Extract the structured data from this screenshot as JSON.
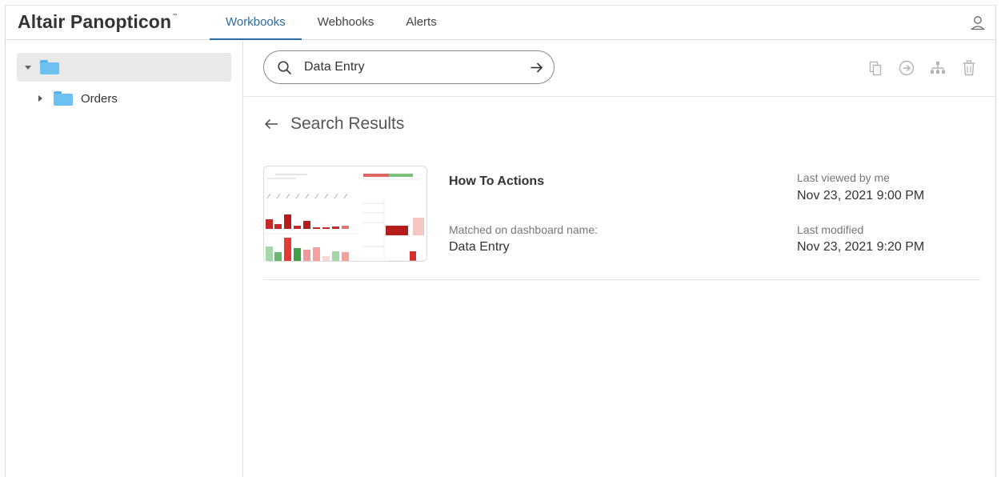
{
  "header": {
    "brand": "Altair Panopticon",
    "brand_mark": "™",
    "tabs": [
      {
        "label": "Workbooks",
        "active": true
      },
      {
        "label": "Webhooks",
        "active": false
      },
      {
        "label": "Alerts",
        "active": false
      }
    ],
    "user_icon": "user-icon"
  },
  "sidebar": {
    "root_label": "",
    "items": [
      {
        "label": "Orders"
      }
    ]
  },
  "toolbar": {
    "search": {
      "value": "Data Entry",
      "placeholder": ""
    },
    "actions": [
      "copy-icon",
      "move-icon",
      "hierarchy-icon",
      "trash-icon"
    ]
  },
  "results": {
    "heading": "Search Results",
    "items": [
      {
        "title": "How To Actions",
        "matched_label": "Matched on dashboard name:",
        "matched_value": "Data Entry",
        "last_viewed_label": "Last viewed by me",
        "last_viewed_value": "Nov 23, 2021 9:00 PM",
        "last_modified_label": "Last modified",
        "last_modified_value": "Nov 23, 2021 9:20 PM"
      }
    ]
  },
  "colors": {
    "accent": "#2b6a9e",
    "folder": "#6cc0f2",
    "thumb_red": "#c62828",
    "thumb_green": "#5cb85c"
  }
}
